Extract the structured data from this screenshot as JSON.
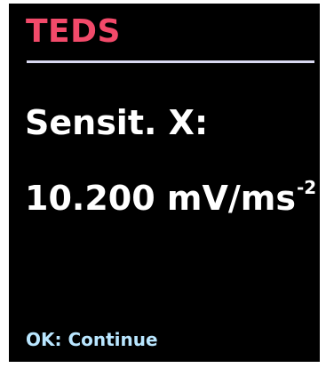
{
  "header": {
    "title": "TEDS"
  },
  "parameter": {
    "label": "Sensit. X:",
    "value": "10.200 mV/ms",
    "exponent": "-2"
  },
  "footer": {
    "hint": "OK: Continue"
  },
  "colors": {
    "background": "#000000",
    "title": "#f24a6a",
    "rule": "#d8d8f0",
    "text": "#ffffff",
    "hint": "#b9e6ff"
  }
}
